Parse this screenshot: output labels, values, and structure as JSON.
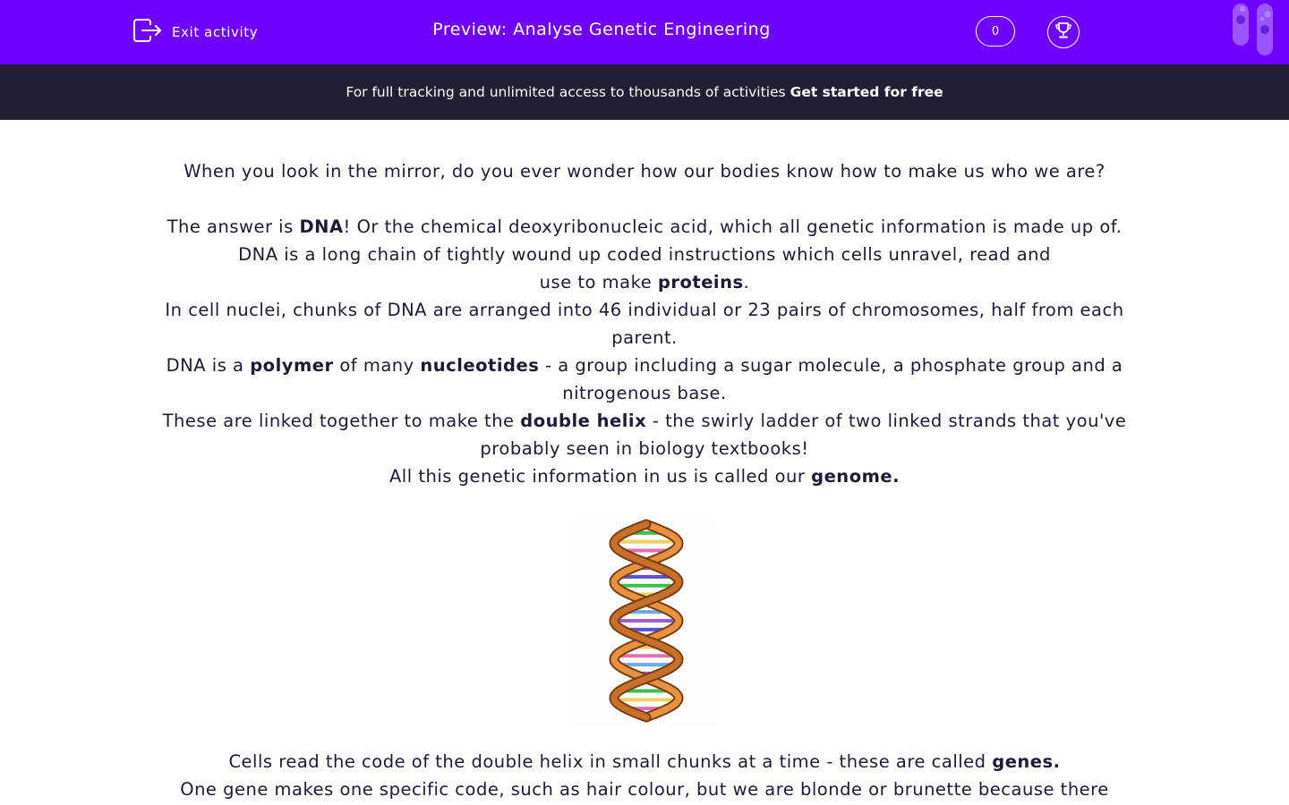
{
  "header": {
    "exit_label": "Exit activity",
    "title": "Preview: Analyse Genetic Engineering",
    "score": "0"
  },
  "banner": {
    "text": "For full tracking and unlimited access to thousands of activities",
    "cta": "Get started for free"
  },
  "content": {
    "intro": "When you look in the mirror, do you ever wonder how our bodies know how to make us who we are?",
    "p1_a": "The answer is ",
    "p1_bold": "DNA",
    "p1_b": "! Or the chemical deoxyribonucleic acid, which all genetic information is made up of.",
    "p2_line1": "DNA is a long chain of tightly wound up coded instructions which cells unravel, read and",
    "p2_line2_a": "use to make ",
    "p2_bold": "proteins",
    "p2_line2_b": ".",
    "p3": "In cell nuclei, chunks of DNA are arranged into 46 individual or 23 pairs of chromosomes, half from each parent.",
    "p4_a": "DNA is a ",
    "p4_bold1": "polymer",
    "p4_b": " of many ",
    "p4_bold2": "nucleotides",
    "p4_c": " - a group including a sugar molecule, a phosphate group and a nitrogenous base.",
    "p5_a": "These are linked together to make the ",
    "p5_bold": "double helix",
    "p5_b": " - the swirly ladder of two linked strands that you've probably seen in biology textbooks!",
    "p6_a": "All this genetic information in us is called our ",
    "p6_bold": "genome.",
    "p7_a": "Cells read the code of the double helix in small chunks at a time - these are called ",
    "p7_bold": "genes.",
    "p8": "One gene makes one specific code, such as hair colour, but we are blonde or brunette because there"
  },
  "icons": {
    "exit": "exit-icon",
    "trophy": "trophy-icon",
    "tubes": "test-tubes-icon",
    "dna": "dna-double-helix-illustration"
  },
  "colors": {
    "header_bg": "#7000ff",
    "banner_bg": "#241e35",
    "text": "#1f1a33"
  }
}
